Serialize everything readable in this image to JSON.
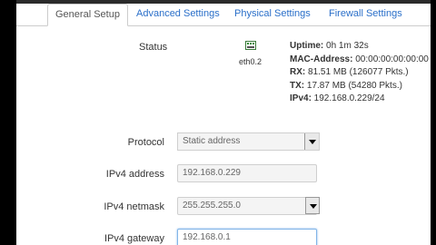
{
  "tabs": [
    {
      "label": "General Setup",
      "active": true
    },
    {
      "label": "Advanced Settings",
      "active": false
    },
    {
      "label": "Physical Settings",
      "active": false
    },
    {
      "label": "Firewall Settings",
      "active": false
    }
  ],
  "status": {
    "label": "Status",
    "interface_icon": "network-port-icon",
    "interface_name": "eth0.2",
    "uptime_label": "Uptime:",
    "uptime_value": " 0h 1m 32s",
    "mac_label": "MAC-Address:",
    "mac_value": " 00:00:00:00:00:00",
    "rx_label": "RX:",
    "rx_value": " 81.51 MB (126077 Pkts.)",
    "tx_label": "TX:",
    "tx_value": " 17.87 MB (54280 Pkts.)",
    "ipv4_label": "IPv4:",
    "ipv4_value": " 192.168.0.229/24"
  },
  "form": {
    "protocol_label": "Protocol",
    "protocol_value": "Static address",
    "ipv4_address_label": "IPv4 address",
    "ipv4_address_value": "192.168.0.229",
    "ipv4_netmask_label": "IPv4 netmask",
    "ipv4_netmask_value": "255.255.255.0",
    "ipv4_gateway_label": "IPv4 gateway",
    "ipv4_gateway_value": "192.168.0.1"
  }
}
